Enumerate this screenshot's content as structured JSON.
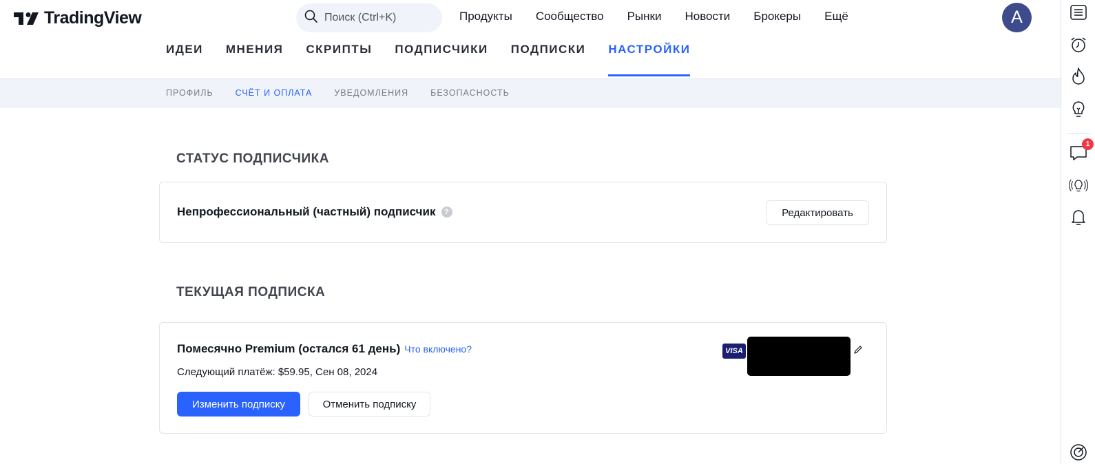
{
  "brand": {
    "name": "TradingView"
  },
  "search": {
    "placeholder": "Поиск (Ctrl+K)"
  },
  "main_nav": [
    "Продукты",
    "Сообщество",
    "Рынки",
    "Новости",
    "Брокеры",
    "Ещё"
  ],
  "user": {
    "initial": "A"
  },
  "profile_tabs": [
    "ИДЕИ",
    "МНЕНИЯ",
    "СКРИПТЫ",
    "ПОДПИСЧИКИ",
    "ПОДПИСКИ",
    "НАСТРОЙКИ"
  ],
  "settings_tabs": [
    "ПРОФИЛЬ",
    "СЧЁТ И ОПЛАТА",
    "УВЕДОМЛЕНИЯ",
    "БЕЗОПАСНОСТЬ"
  ],
  "subscriber_status": {
    "title": "СТАТУС ПОДПИСЧИКА",
    "status": "Непрофессиональный (частный) подписчик",
    "edit_label": "Редактировать"
  },
  "current_subscription": {
    "title": "ТЕКУЩАЯ ПОДПИСКА",
    "plan": "Помесячно Premium (остался 61 день)",
    "whats_included": "Что включено?",
    "next_payment": "Следующий платёж: $59.95, Сен 08, 2024",
    "change_label": "Изменить подписку",
    "cancel_label": "Отменить подписку",
    "card_brand": "VISA"
  },
  "sidebar": {
    "notifications_count": "1"
  },
  "colors": {
    "accent": "#2962ff",
    "avatar": "#3d4a8c",
    "badge": "#f23645",
    "subnav_bg": "#f0f3fa"
  }
}
